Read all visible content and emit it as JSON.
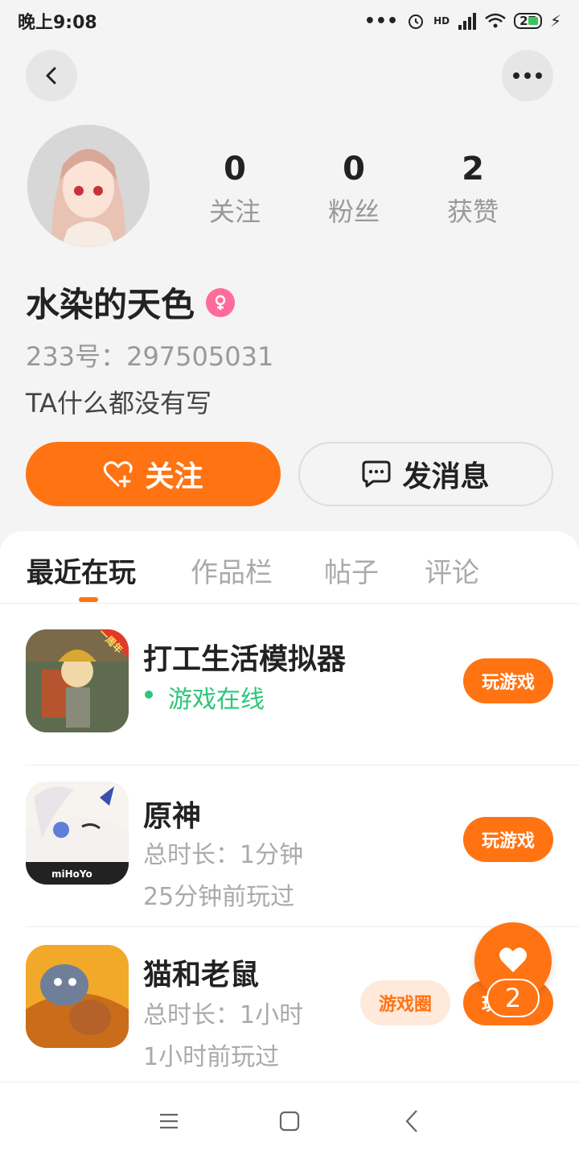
{
  "status_bar": {
    "time": "晚上9:08",
    "battery": "27",
    "network": "HD"
  },
  "profile": {
    "username": "水染的天色",
    "id_line": "233号：297505031",
    "bio": "TA什么都没有写",
    "stats": [
      {
        "value": "0",
        "label": "关注"
      },
      {
        "value": "0",
        "label": "粉丝"
      },
      {
        "value": "2",
        "label": "获赞"
      }
    ],
    "follow_label": "关注",
    "message_label": "发消息"
  },
  "tabs": [
    "最近在玩",
    "作品栏",
    "帖子",
    "评论"
  ],
  "active_tab": "最近在玩",
  "games": [
    {
      "name": "打工生活模拟器",
      "line1": "游戏在线",
      "line2": "",
      "play_label": "玩游戏",
      "badge": "一周年"
    },
    {
      "name": "原神",
      "line1": "总时长：1分钟",
      "line2": "25分钟前玩过",
      "play_label": "玩游戏",
      "icon_text": "miHoYo"
    },
    {
      "name": "猫和老鼠",
      "line1": "总时长：1小时",
      "line2": "1小时前玩过",
      "circle_label": "游戏圈",
      "play_label": "玩游戏"
    }
  ],
  "fab": {
    "count": "2"
  },
  "colors": {
    "accent": "#ff7312",
    "online": "#2cc77a",
    "gender": "#ff6b9a"
  },
  "icons": [
    "back-icon",
    "more-icon",
    "heart-plus-icon",
    "chat-icon",
    "female-icon",
    "heart-icon",
    "menu-icon",
    "home-icon",
    "nav-back-icon"
  ]
}
